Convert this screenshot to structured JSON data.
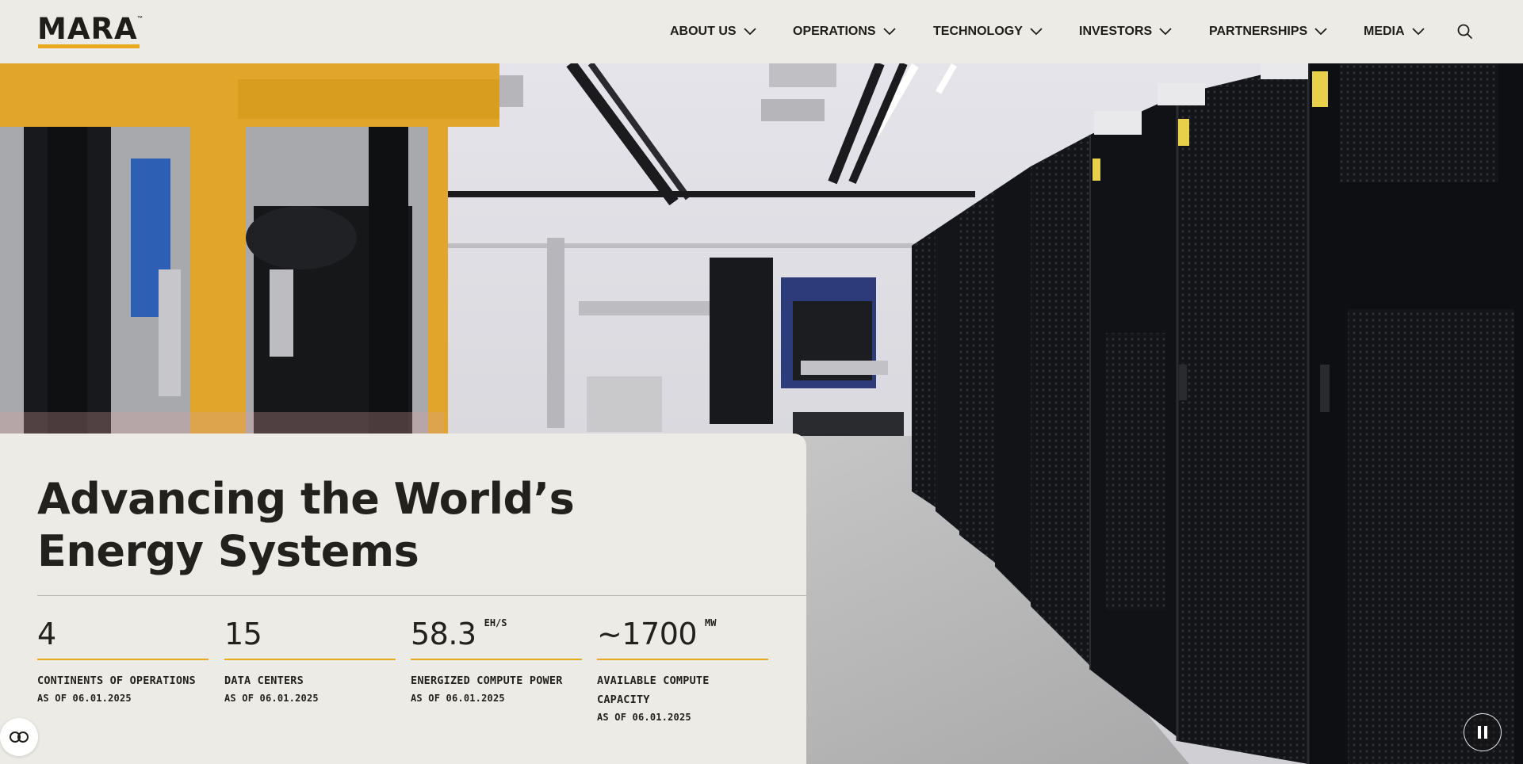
{
  "brand": {
    "logo_text": "MARA",
    "trademark": "™",
    "accent_color": "#e9a91f"
  },
  "nav": {
    "items": [
      {
        "label": "ABOUT US",
        "icon": "chevron-down-icon"
      },
      {
        "label": "OPERATIONS",
        "icon": "chevron-down-icon"
      },
      {
        "label": "TECHNOLOGY",
        "icon": "chevron-down-icon"
      },
      {
        "label": "INVESTORS",
        "icon": "chevron-down-icon"
      },
      {
        "label": "PARTNERSHIPS",
        "icon": "chevron-down-icon"
      },
      {
        "label": "MEDIA",
        "icon": "chevron-down-icon"
      }
    ],
    "search_icon": "search-icon"
  },
  "hero": {
    "headline_line1": "Advancing the World’s",
    "headline_line2": "Energy Systems",
    "background": "data-center-photo"
  },
  "stats": [
    {
      "value": "4",
      "unit": "",
      "label": "CONTINENTS OF OPERATIONS",
      "date": "AS OF 06.01.2025"
    },
    {
      "value": "15",
      "unit": "",
      "label": "DATA CENTERS",
      "date": "AS OF 06.01.2025"
    },
    {
      "value": "58.3",
      "unit": "EH/S",
      "label": "ENERGIZED COMPUTE POWER",
      "date": "AS OF 06.01.2025"
    },
    {
      "value": "~1700",
      "unit": "MW",
      "label": "AVAILABLE COMPUTE CAPACITY",
      "date": "AS OF 06.01.2025"
    }
  ],
  "controls": {
    "cookie_icon": "cookie-settings-icon",
    "pause_icon": "pause-icon"
  }
}
